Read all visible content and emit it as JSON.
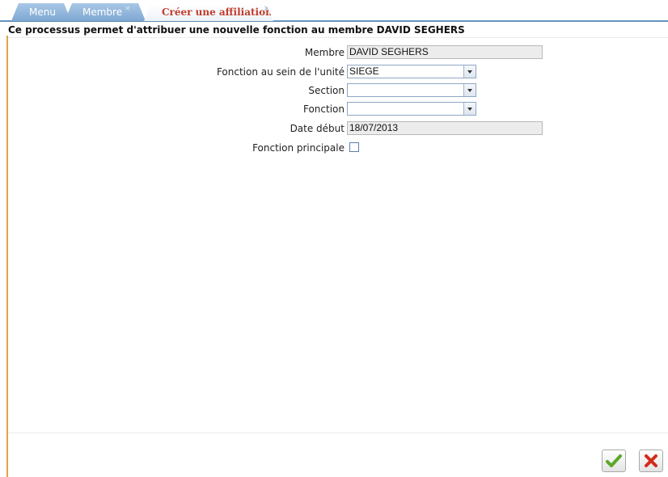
{
  "tabs": [
    {
      "label": "Menu",
      "closable": false,
      "active": false
    },
    {
      "label": "Membre",
      "closable": true,
      "active": false
    },
    {
      "label": "Créer une affiliation",
      "closable": true,
      "active": true
    }
  ],
  "close_glyph": "×",
  "page_title": "Ce processus permet d'attribuer une nouvelle fonction au membre DAVID SEGHERS",
  "form": {
    "membre": {
      "label": "Membre",
      "value": "DAVID SEGHERS"
    },
    "fonction_unite": {
      "label": "Fonction au sein de l'unité",
      "value": "SIEGE"
    },
    "section": {
      "label": "Section",
      "value": ""
    },
    "fonction": {
      "label": "Fonction",
      "value": ""
    },
    "date_debut": {
      "label": "Date début",
      "value": "18/07/2013"
    },
    "fonction_principale": {
      "label": "Fonction principale",
      "checked": false
    }
  },
  "actions": {
    "confirm_icon": "check-icon",
    "cancel_icon": "cross-icon"
  },
  "colors": {
    "tab_inactive": "#7ea8d2",
    "tab_active_text": "#c23b2b",
    "left_border": "#e0a64a",
    "confirm": "#5aa829",
    "cancel": "#d42a1c"
  }
}
